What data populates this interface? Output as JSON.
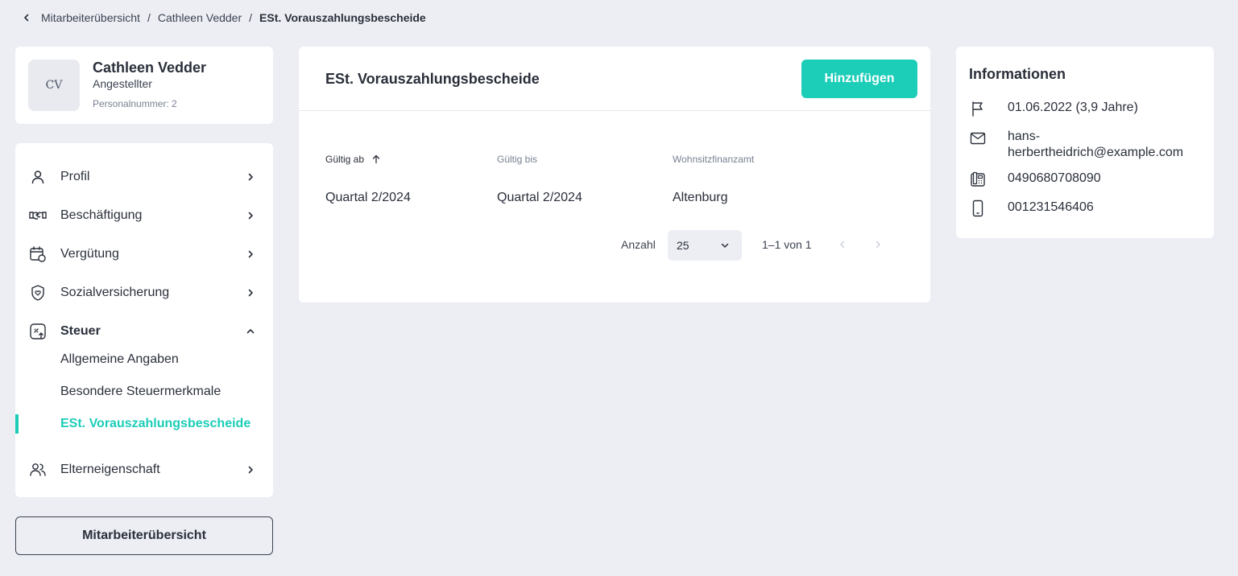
{
  "breadcrumb": {
    "items": [
      "Mitarbeiterübersicht",
      "Cathleen Vedder"
    ],
    "current": "ESt. Vorauszahlungsbescheide",
    "separator": "/"
  },
  "profile": {
    "initials": "CV",
    "name": "Cathleen Vedder",
    "role": "Angestellter",
    "personal_number": "Personalnummer: 2"
  },
  "nav": {
    "items": [
      {
        "label": "Profil",
        "icon": "user-icon"
      },
      {
        "label": "Beschäftigung",
        "icon": "handshake-icon"
      },
      {
        "label": "Vergütung",
        "icon": "calendar-money-icon"
      },
      {
        "label": "Sozialversicherung",
        "icon": "shield-heart-icon"
      },
      {
        "label": "Steuer",
        "icon": "tax-percent-icon"
      },
      {
        "label": "Elterneigenschaft",
        "icon": "people-icon"
      }
    ],
    "sub_items": [
      "Allgemeine Angaben",
      "Besondere Steuermerkmale",
      "ESt. Vorauszahlungsbescheide"
    ],
    "overview_button": "Mitarbeiterübersicht"
  },
  "main": {
    "title": "ESt. Vorauszahlungsbescheide",
    "add_button": "Hinzufügen",
    "columns": [
      "Gültig ab",
      "Gültig bis",
      "Wohnsitzfinanzamt"
    ],
    "rows": [
      {
        "gueltig_ab": "Quartal 2/2024",
        "gueltig_bis": "Quartal 2/2024",
        "finanzamt": "Altenburg"
      }
    ],
    "pagination": {
      "label": "Anzahl",
      "page_size": "25",
      "range": "1–1 von 1"
    }
  },
  "info": {
    "title": "Informationen",
    "entry_date": "01.06.2022 (3,9 Jahre)",
    "email_line1": "hans-",
    "email_line2": "herbertheidrich@example.com",
    "phone": "0490680708090",
    "mobile": "001231546406"
  },
  "colors": {
    "accent": "#1ccdb8",
    "background": "#eceef4",
    "text": "#2a2f3a"
  }
}
